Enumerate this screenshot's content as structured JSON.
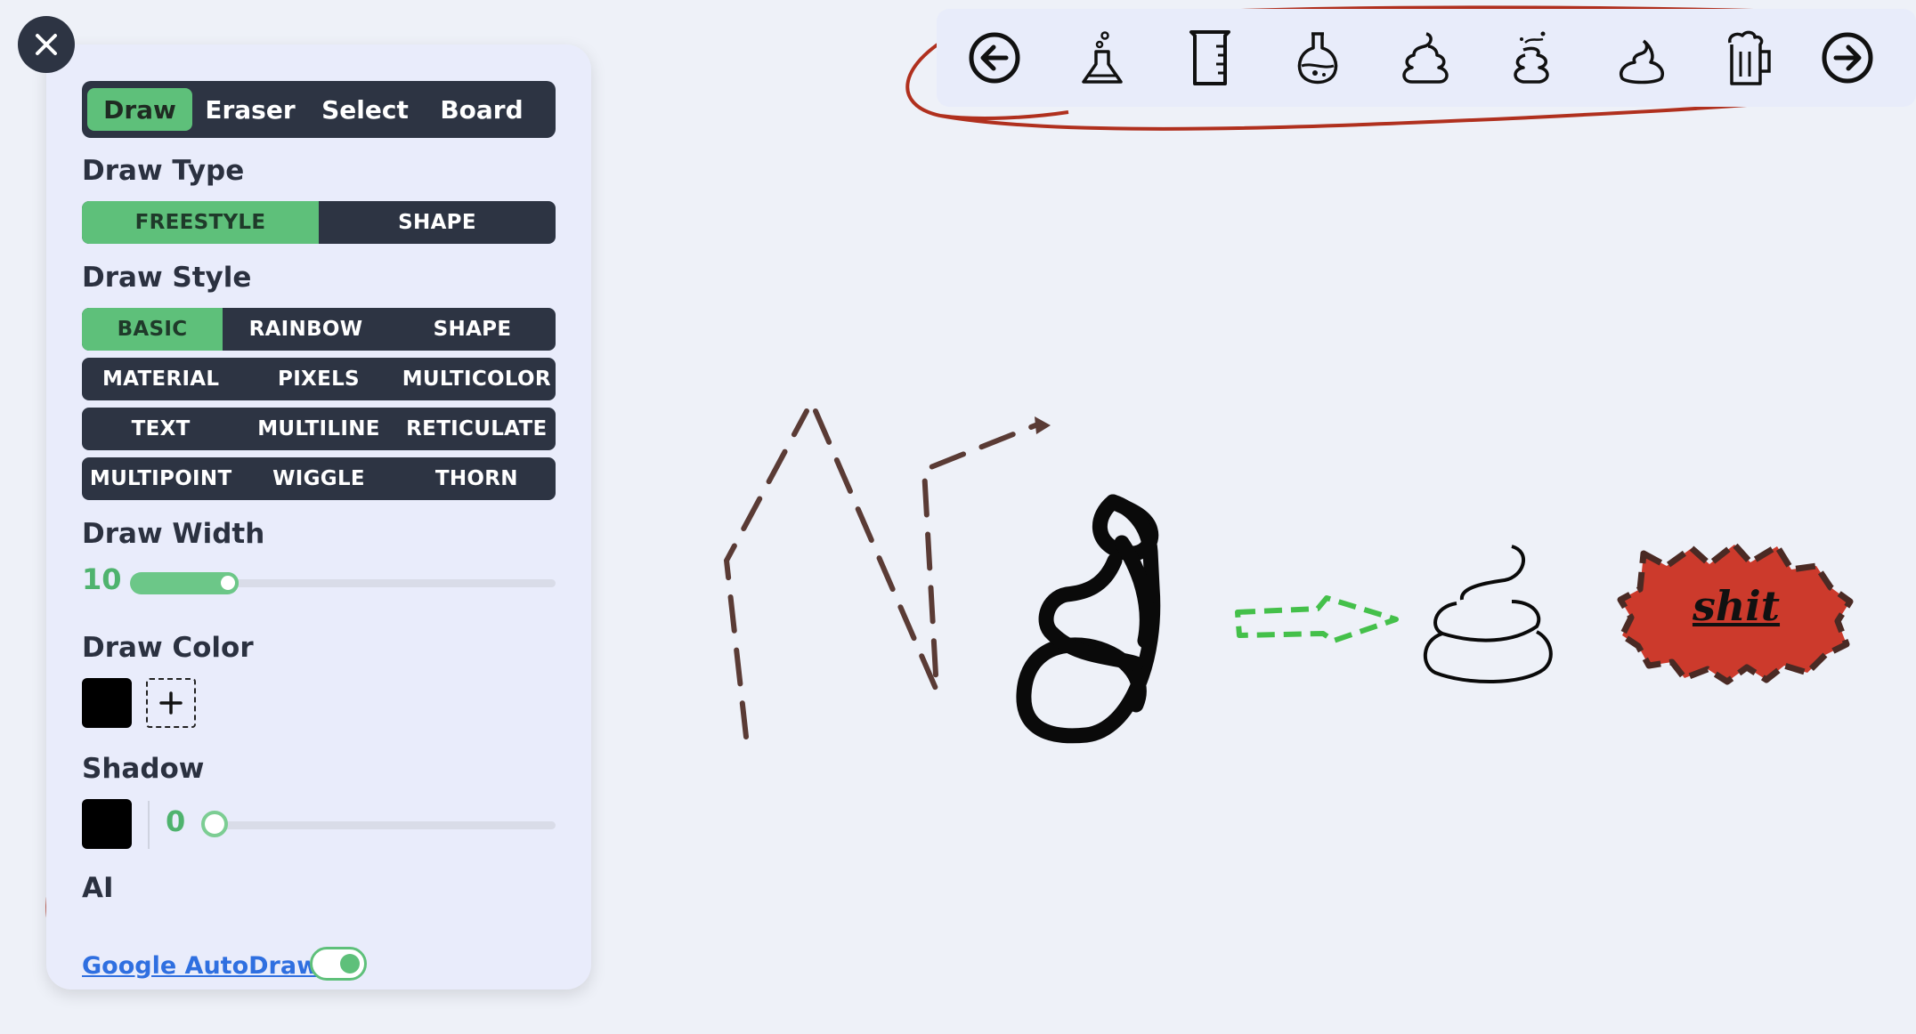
{
  "close": {
    "icon": "close-icon"
  },
  "tabs": [
    {
      "label": "Draw",
      "active": true
    },
    {
      "label": "Eraser",
      "active": false
    },
    {
      "label": "Select",
      "active": false
    },
    {
      "label": "Board",
      "active": false
    }
  ],
  "draw_type": {
    "title": "Draw Type",
    "options": [
      "FREESTYLE",
      "SHAPE"
    ],
    "selected": "FREESTYLE"
  },
  "draw_style": {
    "title": "Draw Style",
    "rows": [
      [
        "BASIC",
        "RAINBOW",
        "SHAPE"
      ],
      [
        "MATERIAL",
        "PIXELS",
        "MULTICOLOR"
      ],
      [
        "TEXT",
        "MULTILINE",
        "RETICULATE"
      ],
      [
        "MULTIPOINT",
        "WIGGLE",
        "THORN"
      ]
    ],
    "selected": "BASIC"
  },
  "draw_width": {
    "title": "Draw Width",
    "value": "10"
  },
  "draw_color": {
    "title": "Draw Color",
    "color": "#000000",
    "add_icon": "plus-icon"
  },
  "shadow": {
    "title": "Shadow",
    "color": "#000000",
    "value": "0"
  },
  "ai": {
    "title": "AI",
    "link": "Google AutoDraw",
    "toggle_on": true
  },
  "toolbar": {
    "icons": [
      "arrow-left-icon",
      "flask-bubbles-icon",
      "beaker-icon",
      "potion-flask-icon",
      "poop-icon",
      "poop-flies-icon",
      "cream-swirl-icon",
      "beer-mug-icon",
      "arrow-right-icon"
    ]
  },
  "canvas": {
    "label_text": "shit",
    "colors": {
      "stroke_brown": "#5a3b35",
      "annotation_red": "#b0301e",
      "dashed_green": "#44c04a",
      "badge_red": "#cc3a2c",
      "accent_green": "#5ec07a",
      "panel_dark": "#2d3443"
    }
  }
}
